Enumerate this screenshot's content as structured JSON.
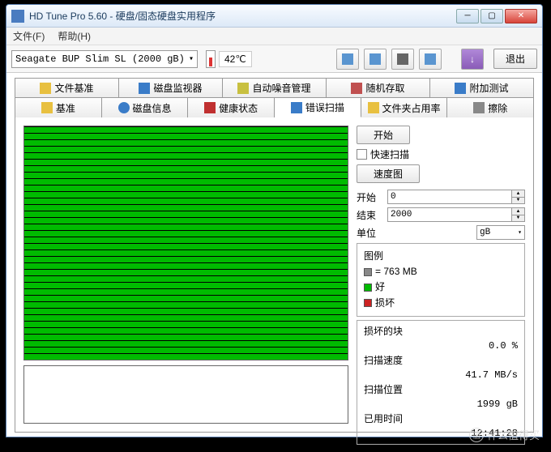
{
  "window": {
    "title": "HD Tune Pro 5.60 - 硬盘/固态硬盘实用程序",
    "menu": {
      "file": "文件(F)",
      "help": "帮助(H)"
    }
  },
  "toolbar": {
    "drive": "Seagate BUP Slim SL (2000 gB)",
    "temperature": "42℃",
    "exit": "退出"
  },
  "tabs_row1": {
    "bench": "文件基准",
    "monitor": "磁盘监视器",
    "aam": "自动噪音管理",
    "random": "随机存取",
    "extra": "附加测试"
  },
  "tabs_row2": {
    "base": "基准",
    "info": "磁盘信息",
    "health": "健康状态",
    "scan": "错误扫描",
    "folder": "文件夹占用率",
    "erase": "擦除"
  },
  "scan": {
    "start": "开始",
    "quick": "快速扫描",
    "speedmap": "速度图",
    "start_label": "开始",
    "start_val": "0",
    "end_label": "结束",
    "end_val": "2000",
    "unit_label": "单位",
    "unit_val": "gB",
    "legend": {
      "title": "图例",
      "block": "= 763 MB",
      "ok": "好",
      "bad": "损坏"
    },
    "stats": {
      "damaged_label": "损坏的块",
      "damaged_val": "0.0 %",
      "speed_label": "扫描速度",
      "speed_val": "41.7 MB/s",
      "pos_label": "扫描位置",
      "pos_val": "1999 gB",
      "elapsed_label": "已用时间",
      "elapsed_val": "12:41:28"
    }
  },
  "watermark": {
    "brand": "什么值得买",
    "icon": "值"
  }
}
